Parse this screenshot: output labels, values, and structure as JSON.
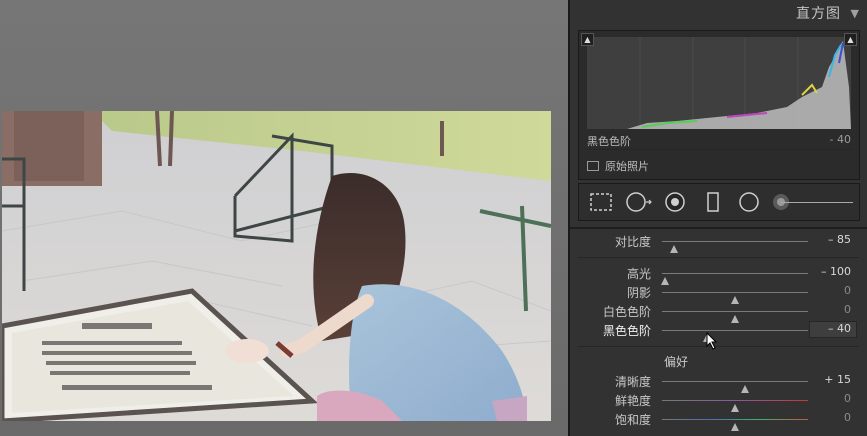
{
  "histogram": {
    "title": "直方图",
    "collapse_icon": "triangle-down-icon",
    "info_label": "黑色色阶",
    "info_value": "- 40",
    "original_photo_label": "原始照片"
  },
  "tools": [
    "crop-overlay-icon",
    "spot-removal-icon",
    "red-eye-icon",
    "graduated-filter-icon",
    "radial-filter-icon",
    "adjustment-brush-icon"
  ],
  "tone": {
    "sliders": [
      {
        "id": "contrast",
        "label": "对比度",
        "value": "– 85",
        "position": 0.08
      },
      {
        "id": "highlights",
        "label": "高光",
        "value": "– 100",
        "position": 0.0
      },
      {
        "id": "shadows",
        "label": "阴影",
        "value": "0",
        "position": 0.5
      },
      {
        "id": "whites",
        "label": "白色色阶",
        "value": "0",
        "position": 0.5
      },
      {
        "id": "blacks",
        "label": "黑色色阶",
        "value": "– 40",
        "position": 0.31
      }
    ]
  },
  "presence": {
    "title": "偏好",
    "sliders": [
      {
        "id": "clarity",
        "label": "清晰度",
        "value": "+ 15",
        "position": 0.57
      },
      {
        "id": "vibrance",
        "label": "鲜艳度",
        "value": "0",
        "position": 0.5
      },
      {
        "id": "saturation",
        "label": "饱和度",
        "value": "0",
        "position": 0.5
      }
    ]
  },
  "colors": {
    "panel_bg": "#323232",
    "canvas_bg": "#6f6f6f",
    "accent_text": "#d8d8d8"
  }
}
